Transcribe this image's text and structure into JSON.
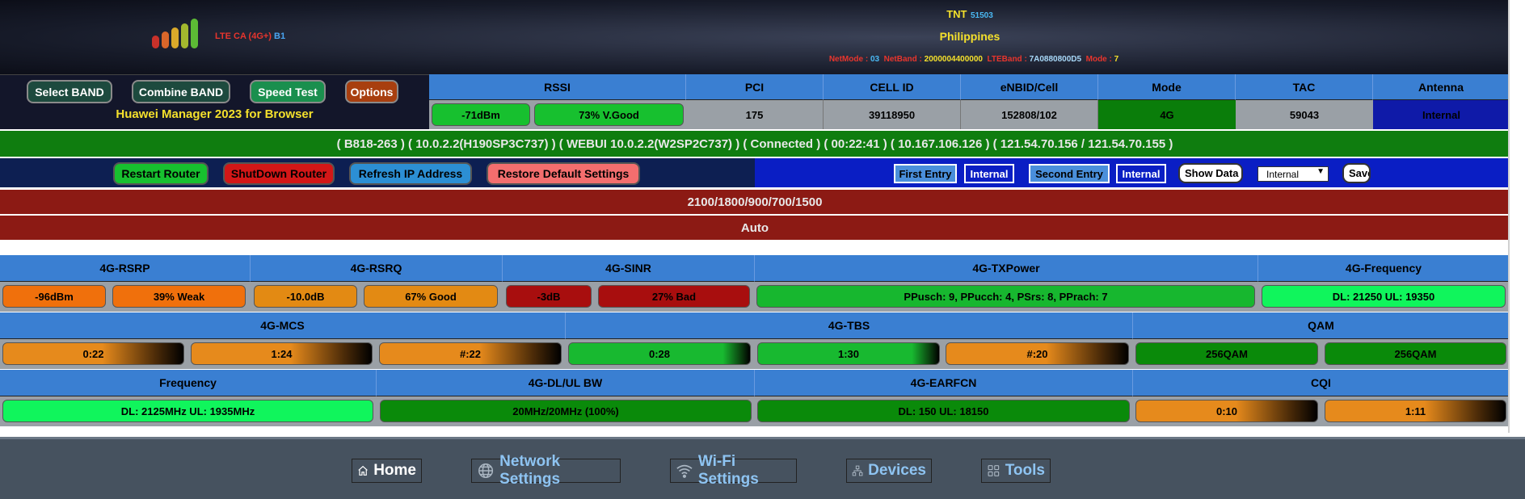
{
  "header": {
    "lte_label": "LTE CA (4G+)",
    "band_label": "B1",
    "carrier": "TNT",
    "carrier_code": "51503",
    "country": "Philippines",
    "netmode_label": "NetMode :",
    "netmode_value": "03",
    "netband_label": "NetBand :",
    "netband_value": "2000004400000",
    "lteband_label": "LTEBand :",
    "lteband_value": "7A0880800D5",
    "mode_label": "Mode :",
    "mode_value": "7"
  },
  "controls": {
    "select_band": "Select BAND",
    "combine_band": "Combine BAND",
    "speed_test": "Speed Test",
    "options": "Options",
    "app_title": "Huawei Manager 2023 for Browser"
  },
  "top_table": {
    "rssi_header": "RSSI",
    "rssi_value": "-71dBm",
    "rssi_quality": "73% V.Good",
    "pci_header": "PCI",
    "pci_value": "175",
    "cellid_header": "CELL ID",
    "cellid_value": "39118950",
    "enbid_header": "eNBID/Cell",
    "enbid_value": "152808/102",
    "mode_header": "Mode",
    "mode_value": "4G",
    "tac_header": "TAC",
    "tac_value": "59043",
    "antenna_header": "Antenna",
    "antenna_value": "Internal"
  },
  "info_line": "( B818-263 ) ( 10.0.2.2(H190SP3C737) ) ( WEBUI 10.0.2.2(W2SP2C737) ) ( Connected ) ( 00:22:41 ) ( 10.167.106.126 ) ( 121.54.70.156 / 121.54.70.155 )",
  "actions": {
    "restart": "Restart Router",
    "shutdown": "ShutDown Router",
    "refresh_ip": "Refresh IP Address",
    "restore": "Restore Default Settings",
    "first_entry": "First Entry",
    "first_internal": "Internal",
    "second_entry": "Second Entry",
    "second_internal": "Internal",
    "show_data": "Show Data",
    "select_value": "Internal",
    "save": "Save"
  },
  "bands_line": "2100/1800/900/700/1500",
  "auto_line": "Auto",
  "signal": {
    "rsrp_header": "4G-RSRP",
    "rsrp_value": "-96dBm",
    "rsrp_quality": "39% Weak",
    "rsrq_header": "4G-RSRQ",
    "rsrq_value": "-10.0dB",
    "rsrq_quality": "67% Good",
    "sinr_header": "4G-SINR",
    "sinr_value": "-3dB",
    "sinr_quality": "27% Bad",
    "tx_header": "4G-TXPower",
    "tx_value": "PPusch: 9, PPucch: 4, PSrs: 8, PPrach: 7",
    "freq_header": "4G-Frequency",
    "freq_value": "DL: 21250 UL: 19350"
  },
  "mcs": {
    "mcs_header": "4G-MCS",
    "mcs_0": "0:22",
    "mcs_1": "1:24",
    "mcs_2": "#:22",
    "tbs_header": "4G-TBS",
    "tbs_0": "0:28",
    "tbs_1": "1:30",
    "tbs_2": "#:20",
    "qam_header": "QAM",
    "qam_0": "256QAM",
    "qam_1": "256QAM"
  },
  "bottom": {
    "frequency_header": "Frequency",
    "frequency_value": "DL: 2125MHz UL: 1935MHz",
    "bw_header": "4G-DL/UL BW",
    "bw_value": "20MHz/20MHz (100%)",
    "earfcn_header": "4G-EARFCN",
    "earfcn_value": "DL: 150 UL: 18150",
    "cqi_header": "CQI",
    "cqi_0": "0:10",
    "cqi_1": "1:11"
  },
  "nav": {
    "home": "Home",
    "network": "Network Settings",
    "wifi": "Wi-Fi Settings",
    "devices": "Devices",
    "tools": "Tools"
  },
  "colors": {
    "header_bg": "#1a1e2e",
    "cell_blue": "#3a7fd2",
    "ok_green": "#17b72f",
    "dark_green": "#0a7d0a",
    "banner_red": "#8c1a14",
    "nav_bg": "#46525f"
  }
}
